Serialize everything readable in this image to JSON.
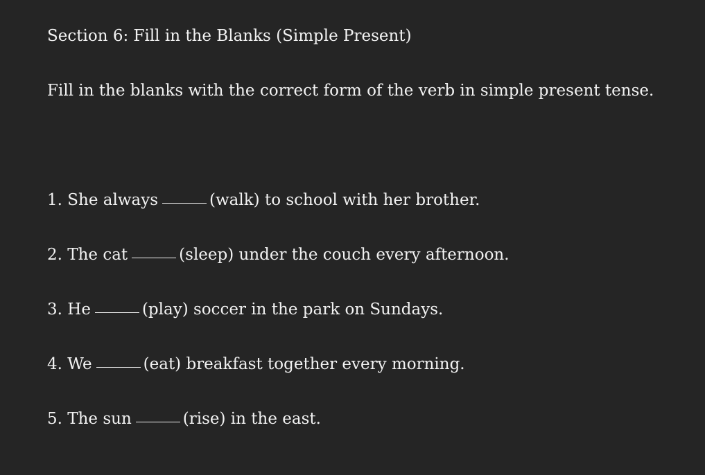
{
  "document": {
    "title": "Section 6: Fill in the Blanks (Simple Present)",
    "instruction": "Fill in the blanks with the correct form of the verb in simple present tense."
  },
  "questions": [
    {
      "prefix": "1. She always",
      "suffix": "(walk) to school with her brother."
    },
    {
      "prefix": "2. The cat",
      "suffix": "(sleep) under the couch every afternoon."
    },
    {
      "prefix": "3. He",
      "suffix": "(play) soccer in the park on Sundays."
    },
    {
      "prefix": "4. We",
      "suffix": "(eat) breakfast together every morning."
    },
    {
      "prefix": "5. The sun",
      "suffix": "(rise) in the east."
    }
  ]
}
